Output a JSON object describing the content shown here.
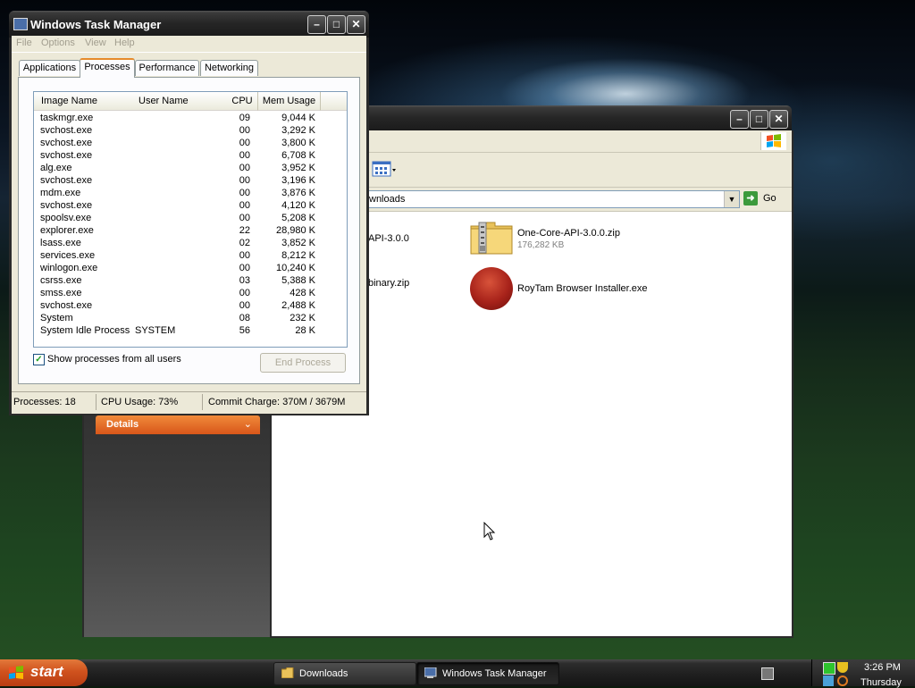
{
  "task_manager": {
    "title": "Windows Task Manager",
    "menu": [
      "File",
      "Options",
      "View",
      "Help"
    ],
    "tabs": [
      "Applications",
      "Processes",
      "Performance",
      "Networking"
    ],
    "active_tab": "Processes",
    "columns": [
      "Image Name",
      "User Name",
      "CPU",
      "Mem Usage"
    ],
    "processes": [
      {
        "name": "taskmgr.exe",
        "user": "",
        "cpu": "09",
        "mem": "9,044 K"
      },
      {
        "name": "svchost.exe",
        "user": "",
        "cpu": "00",
        "mem": "3,292 K"
      },
      {
        "name": "svchost.exe",
        "user": "",
        "cpu": "00",
        "mem": "3,800 K"
      },
      {
        "name": "svchost.exe",
        "user": "",
        "cpu": "00",
        "mem": "6,708 K"
      },
      {
        "name": "alg.exe",
        "user": "",
        "cpu": "00",
        "mem": "3,952 K"
      },
      {
        "name": "svchost.exe",
        "user": "",
        "cpu": "00",
        "mem": "3,196 K"
      },
      {
        "name": "mdm.exe",
        "user": "",
        "cpu": "00",
        "mem": "3,876 K"
      },
      {
        "name": "svchost.exe",
        "user": "",
        "cpu": "00",
        "mem": "4,120 K"
      },
      {
        "name": "spoolsv.exe",
        "user": "",
        "cpu": "00",
        "mem": "5,208 K"
      },
      {
        "name": "explorer.exe",
        "user": "",
        "cpu": "22",
        "mem": "28,980 K"
      },
      {
        "name": "lsass.exe",
        "user": "",
        "cpu": "02",
        "mem": "3,852 K"
      },
      {
        "name": "services.exe",
        "user": "",
        "cpu": "00",
        "mem": "8,212 K"
      },
      {
        "name": "winlogon.exe",
        "user": "",
        "cpu": "00",
        "mem": "10,240 K"
      },
      {
        "name": "csrss.exe",
        "user": "",
        "cpu": "03",
        "mem": "5,388 K"
      },
      {
        "name": "smss.exe",
        "user": "",
        "cpu": "00",
        "mem": "428 K"
      },
      {
        "name": "svchost.exe",
        "user": "",
        "cpu": "00",
        "mem": "2,488 K"
      },
      {
        "name": "System",
        "user": "",
        "cpu": "08",
        "mem": "232 K"
      },
      {
        "name": "System Idle Process",
        "user": "SYSTEM",
        "cpu": "56",
        "mem": "28 K"
      }
    ],
    "show_all_label": "Show processes from all users",
    "show_all_checked": true,
    "end_process_label": "End Process",
    "status": {
      "processes": "Processes: 18",
      "cpu": "CPU Usage: 73%",
      "commit": "Commit Charge: 370M / 3679M"
    }
  },
  "explorer": {
    "address_partial": "wnloads",
    "go_label": "Go",
    "details_label": "Details",
    "files": [
      {
        "name_partial": "API-3.0.0"
      },
      {
        "name_partial": "binary.zip"
      },
      {
        "name": "One-Core-API-3.0.0.zip",
        "size": "176,282 KB",
        "icon": "zip-folder-icon"
      },
      {
        "name": "RoyTam Browser Installer.exe",
        "icon": "browser-installer-icon"
      }
    ]
  },
  "taskbar": {
    "start_label": "start",
    "tasks": [
      {
        "label": "Downloads",
        "icon": "folder-icon",
        "active": false
      },
      {
        "label": "Windows Task Manager",
        "icon": "task-manager-icon",
        "active": true
      }
    ],
    "time": "3:26 PM",
    "day": "Thursday"
  },
  "colors": {
    "accent_orange": "#e68b2c",
    "start_orange": "#d0521e",
    "title_dark": "#262626"
  }
}
